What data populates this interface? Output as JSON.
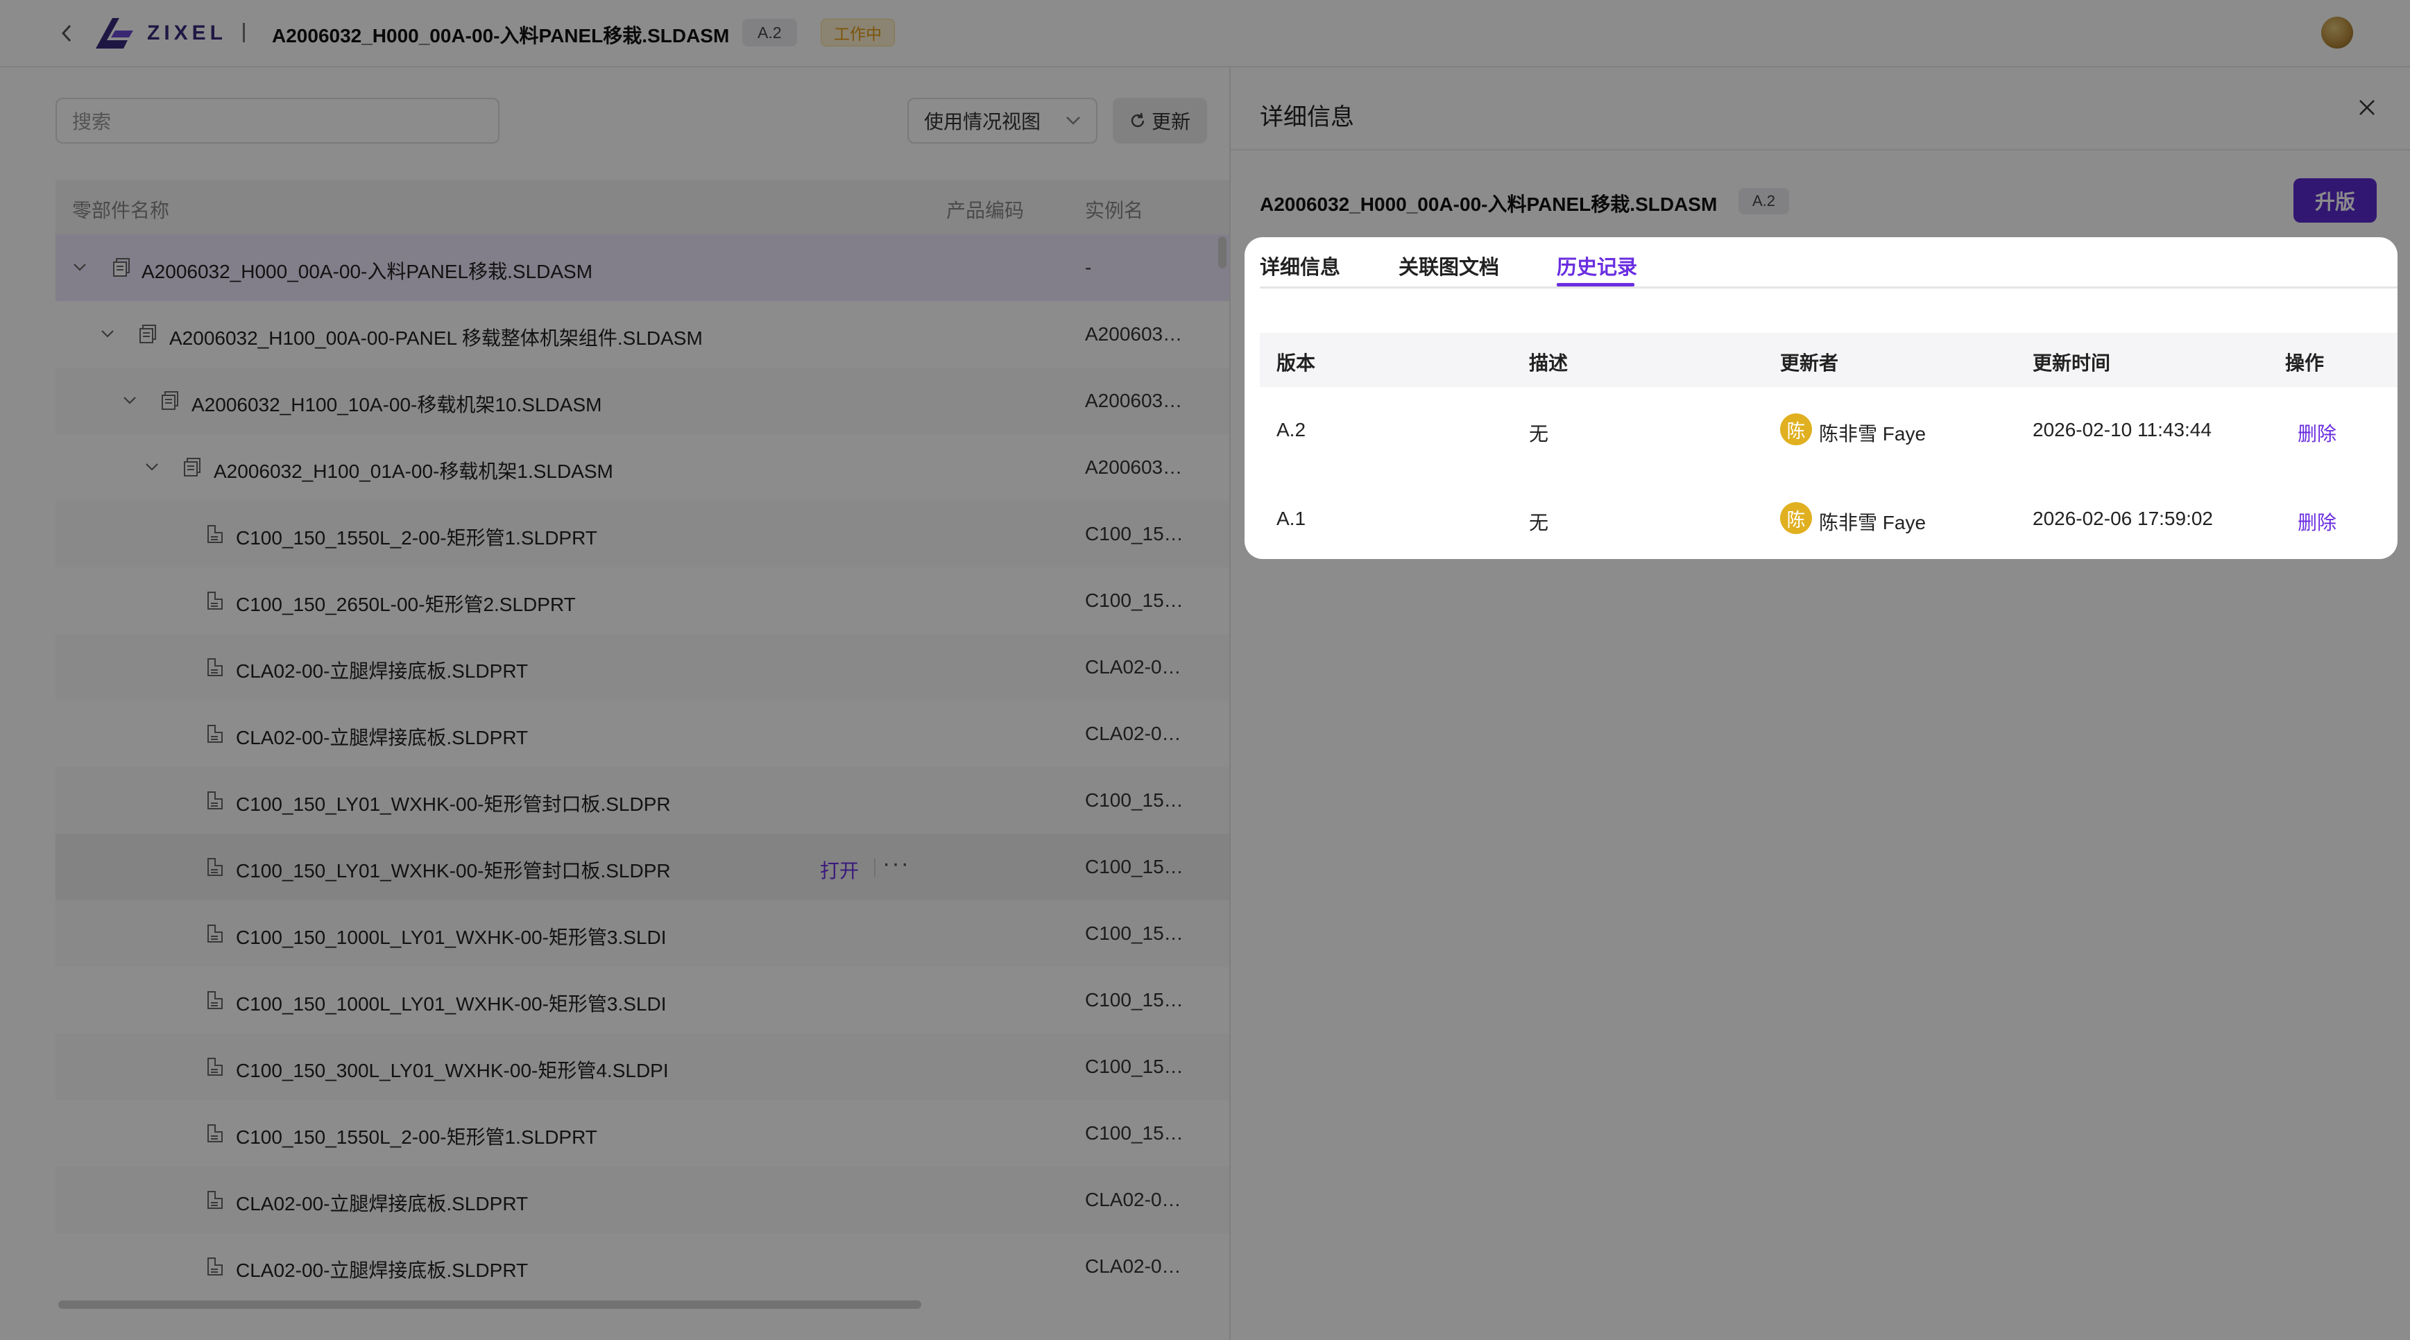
{
  "topbar": {
    "logo_text": "ZIXEL",
    "doc_title": "A2006032_H000_00A-00-入料PANEL移栽.SLDASM",
    "version": "A.2",
    "status": "工作中"
  },
  "left": {
    "search_placeholder": "搜索",
    "view_select": "使用情况视图",
    "refresh_label": "更新",
    "columns": {
      "name": "零部件名称",
      "code": "产品编码",
      "instance": "实例名"
    },
    "rows": [
      {
        "name": "A2006032_H000_00A-00-入料PANEL移栽.SLDASM",
        "instance": "-",
        "level": 0,
        "type": "asm",
        "expand": true
      },
      {
        "name": "A2006032_H100_00A-00-PANEL 移载整体机架组件.SLDASM",
        "instance": "A200603…",
        "level": 1,
        "type": "asm",
        "expand": true
      },
      {
        "name": "A2006032_H100_10A-00-移载机架10.SLDASM",
        "instance": "A200603…",
        "level": 2,
        "type": "asm",
        "expand": true
      },
      {
        "name": "A2006032_H100_01A-00-移载机架1.SLDASM",
        "instance": "A200603…",
        "level": 3,
        "type": "asm",
        "expand": true
      },
      {
        "name": "C100_150_1550L_2-00-矩形管1.SLDPRT",
        "instance": "C100_15…",
        "level": 4,
        "type": "prt"
      },
      {
        "name": "C100_150_2650L-00-矩形管2.SLDPRT",
        "instance": "C100_15…",
        "level": 4,
        "type": "prt"
      },
      {
        "name": "CLA02-00-立腿焊接底板.SLDPRT",
        "instance": "CLA02-0…",
        "level": 4,
        "type": "prt"
      },
      {
        "name": "CLA02-00-立腿焊接底板.SLDPRT",
        "instance": "CLA02-0…",
        "level": 4,
        "type": "prt"
      },
      {
        "name": "C100_150_LY01_WXHK-00-矩形管封口板.SLDPR",
        "instance": "C100_15…",
        "level": 4,
        "type": "prt"
      },
      {
        "name": "C100_150_LY01_WXHK-00-矩形管封口板.SLDPR",
        "instance": "C100_15…",
        "level": 4,
        "type": "prt",
        "hover": true
      },
      {
        "name": "C100_150_1000L_LY01_WXHK-00-矩形管3.SLDI",
        "instance": "C100_15…",
        "level": 4,
        "type": "prt"
      },
      {
        "name": "C100_150_1000L_LY01_WXHK-00-矩形管3.SLDI",
        "instance": "C100_15…",
        "level": 4,
        "type": "prt"
      },
      {
        "name": "C100_150_300L_LY01_WXHK-00-矩形管4.SLDPI",
        "instance": "C100_15…",
        "level": 4,
        "type": "prt"
      },
      {
        "name": "C100_150_1550L_2-00-矩形管1.SLDPRT",
        "instance": "C100_15…",
        "level": 4,
        "type": "prt"
      },
      {
        "name": "CLA02-00-立腿焊接底板.SLDPRT",
        "instance": "CLA02-0…",
        "level": 4,
        "type": "prt"
      },
      {
        "name": "CLA02-00-立腿焊接底板.SLDPRT",
        "instance": "CLA02-0…",
        "level": 4,
        "type": "prt"
      }
    ],
    "hover_open": "打开",
    "hover_more": "···"
  },
  "detail": {
    "title": "详细信息",
    "doc_name": "A2006032_H000_00A-00-入料PANEL移栽.SLDASM",
    "version": "A.2",
    "upgrade_label": "升版",
    "tabs": [
      {
        "label": "详细信息",
        "active": false
      },
      {
        "label": "关联图文档",
        "active": false
      },
      {
        "label": "历史记录",
        "active": true
      }
    ],
    "history": {
      "columns": [
        "版本",
        "描述",
        "更新者",
        "更新时间",
        "操作"
      ],
      "rows": [
        {
          "version": "A.2",
          "desc": "无",
          "avatar": "陈",
          "user": "陈非雪 Faye",
          "time": "2026-02-10 11:43:44",
          "action": "删除"
        },
        {
          "version": "A.1",
          "desc": "无",
          "avatar": "陈",
          "user": "陈非雪 Faye",
          "time": "2026-02-06 17:59:02",
          "action": "删除"
        }
      ]
    }
  },
  "colors": {
    "accent": "#6a2ee0",
    "upgrade": "#5b2bd0",
    "status_bg": "#fff1cf",
    "status_text": "#e09a15",
    "avatar": "#e0b020"
  }
}
